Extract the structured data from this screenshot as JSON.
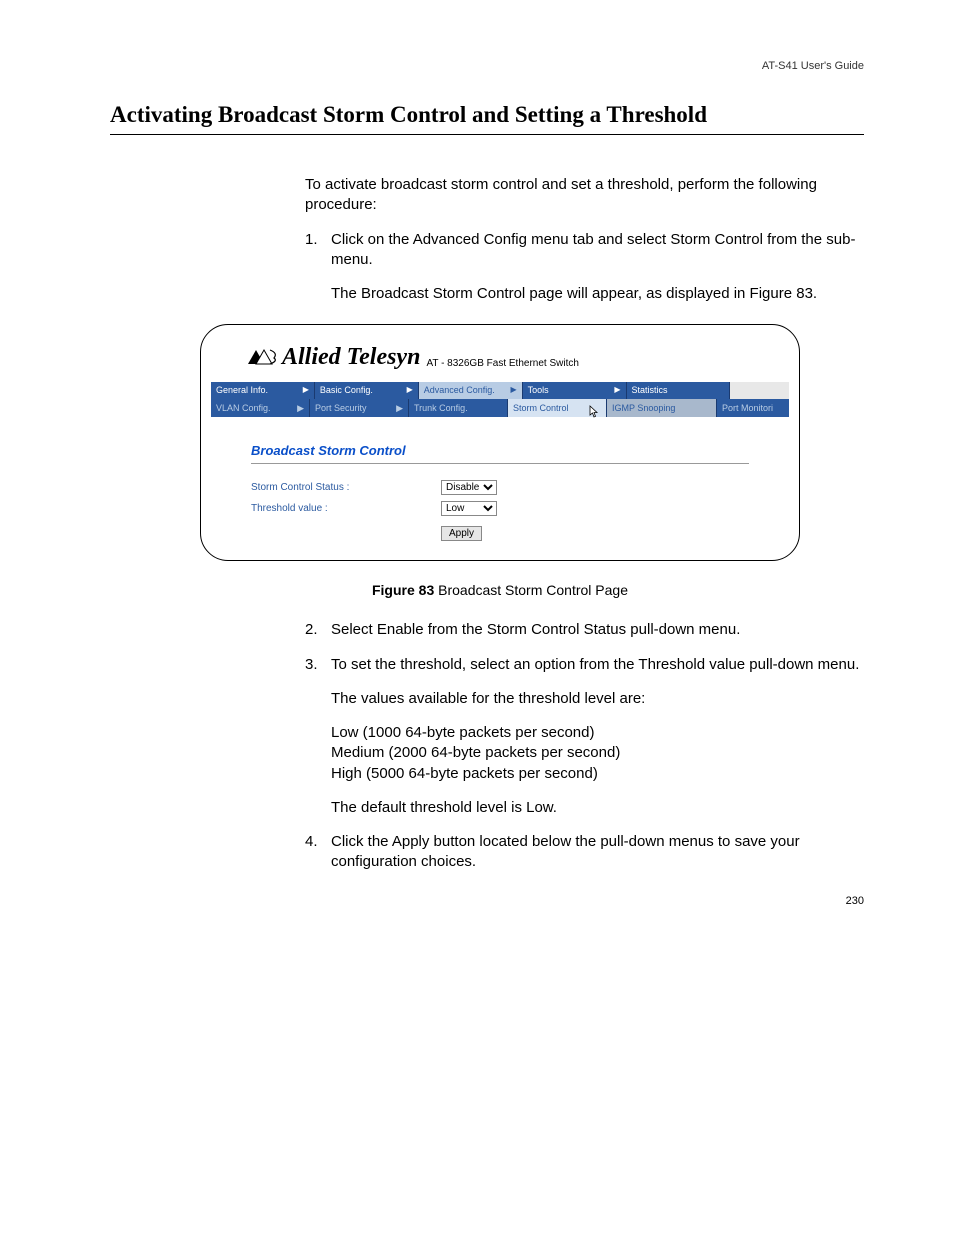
{
  "header": {
    "guide": "AT-S41 User's Guide"
  },
  "title": "Activating Broadcast Storm Control and Setting a Threshold",
  "intro": "To activate broadcast storm control and set a threshold, perform the following procedure:",
  "steps": {
    "s1_num": "1.",
    "s1": "Click on the Advanced Config menu tab and select Storm Control from the sub-menu.",
    "s1_sub": "The Broadcast Storm Control page will appear, as displayed in Figure 83.",
    "s2_num": "2.",
    "s2": "Select Enable from the Storm Control Status pull-down menu.",
    "s3_num": "3.",
    "s3": "To set the threshold, select an option from the Threshold value pull-down menu.",
    "s3_sub1": "The values available for the threshold level are:",
    "s3_low": "Low (1000 64-byte packets per second)",
    "s3_med": "Medium (2000 64-byte packets per second)",
    "s3_high": "High (5000 64-byte packets per second)",
    "s3_default": "The default threshold level is Low.",
    "s4_num": "4.",
    "s4": "Click the Apply button located below the pull-down menus to save your configuration choices."
  },
  "figure": {
    "caption_bold": "Figure 83",
    "caption_rest": "  Broadcast Storm Control Page",
    "logo_text": "Allied Telesyn",
    "model": "AT - 8326GB Fast Ethernet Switch",
    "tabs": {
      "general": "General Info.",
      "basic": "Basic Config.",
      "advanced": "Advanced Config.",
      "tools": "Tools",
      "stats": "Statistics"
    },
    "subtabs": {
      "vlan": "VLAN Config.",
      "portsec": "Port Security",
      "trunk": "Trunk Config.",
      "storm": "Storm Control",
      "igmp": "IGMP Snooping",
      "portmon": "Port Monitori"
    },
    "panel_title": "Broadcast Storm Control",
    "form": {
      "status_label": "Storm Control Status :",
      "status_value": "Disable",
      "threshold_label": "Threshold value :",
      "threshold_value": "Low",
      "apply": "Apply"
    }
  },
  "page_number": "230"
}
